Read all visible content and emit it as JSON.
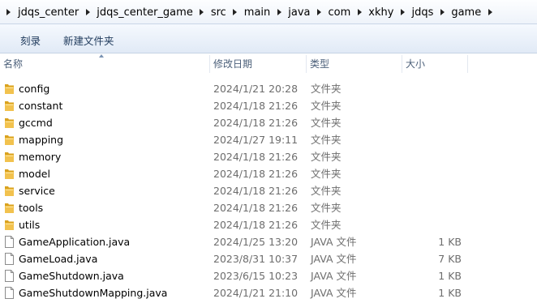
{
  "breadcrumb": [
    "jdqs_center",
    "jdqs_center_game",
    "src",
    "main",
    "java",
    "com",
    "xkhy",
    "jdqs",
    "game"
  ],
  "toolbar": {
    "burn_label": "刻录",
    "new_folder_label": "新建文件夹"
  },
  "columns": {
    "name": "名称",
    "date": "修改日期",
    "type": "类型",
    "size": "大小"
  },
  "files": [
    {
      "name": "config",
      "date": "2024/1/21 20:28",
      "type": "文件夹",
      "size": "",
      "icon": "folder-icon"
    },
    {
      "name": "constant",
      "date": "2024/1/18 21:26",
      "type": "文件夹",
      "size": "",
      "icon": "folder-icon"
    },
    {
      "name": "gccmd",
      "date": "2024/1/18 21:26",
      "type": "文件夹",
      "size": "",
      "icon": "folder-icon"
    },
    {
      "name": "mapping",
      "date": "2024/1/27 19:11",
      "type": "文件夹",
      "size": "",
      "icon": "folder-icon"
    },
    {
      "name": "memory",
      "date": "2024/1/18 21:26",
      "type": "文件夹",
      "size": "",
      "icon": "folder-icon"
    },
    {
      "name": "model",
      "date": "2024/1/18 21:26",
      "type": "文件夹",
      "size": "",
      "icon": "folder-icon"
    },
    {
      "name": "service",
      "date": "2024/1/18 21:26",
      "type": "文件夹",
      "size": "",
      "icon": "folder-icon"
    },
    {
      "name": "tools",
      "date": "2024/1/18 21:26",
      "type": "文件夹",
      "size": "",
      "icon": "folder-icon"
    },
    {
      "name": "utils",
      "date": "2024/1/18 21:26",
      "type": "文件夹",
      "size": "",
      "icon": "folder-icon"
    },
    {
      "name": "GameApplication.java",
      "date": "2024/1/25 13:20",
      "type": "JAVA 文件",
      "size": "1 KB",
      "icon": "file-icon"
    },
    {
      "name": "GameLoad.java",
      "date": "2023/8/31 10:37",
      "type": "JAVA 文件",
      "size": "7 KB",
      "icon": "file-icon"
    },
    {
      "name": "GameShutdown.java",
      "date": "2023/6/15 10:23",
      "type": "JAVA 文件",
      "size": "1 KB",
      "icon": "file-icon"
    },
    {
      "name": "GameShutdownMapping.java",
      "date": "2024/1/21 21:10",
      "type": "JAVA 文件",
      "size": "1 KB",
      "icon": "file-icon"
    }
  ],
  "colors": {
    "folder": "#f2c24e",
    "folder_dark": "#d9a21f",
    "header_text": "#4c607a",
    "meta_text": "#6d6d6d"
  }
}
